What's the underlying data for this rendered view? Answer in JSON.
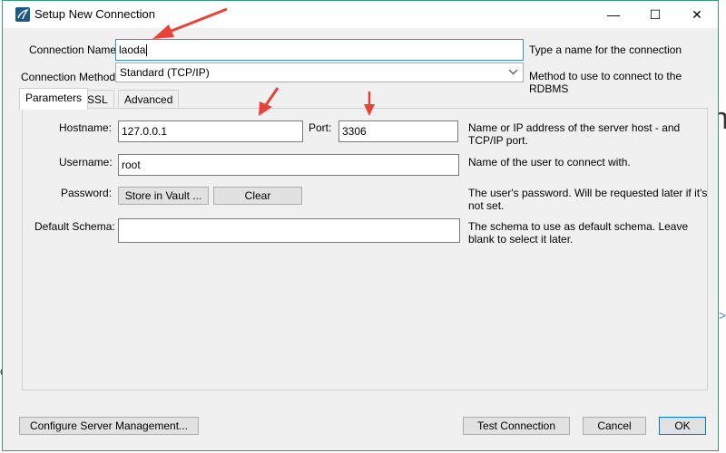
{
  "window": {
    "title": "Setup New Connection",
    "controls": {
      "minimize": "—",
      "maximize": "☐",
      "close": "✕"
    }
  },
  "connection_name": {
    "label": "Connection Name:",
    "value": "laoda",
    "hint": "Type a name for the connection"
  },
  "connection_method": {
    "label": "Connection Method:",
    "value": "Standard (TCP/IP)",
    "hint": "Method to use to connect to the RDBMS"
  },
  "tabs": [
    {
      "label": "Parameters",
      "active": true
    },
    {
      "label": "SSL",
      "active": false
    },
    {
      "label": "Advanced",
      "active": false
    }
  ],
  "params": {
    "hostname": {
      "label": "Hostname:",
      "value": "127.0.0.1"
    },
    "port": {
      "label": "Port:",
      "value": "3306"
    },
    "hostname_hint_1": "Name or IP address of the server host - and",
    "hostname_hint_2": "TCP/IP port.",
    "username": {
      "label": "Username:",
      "value": "root",
      "hint": "Name of the user to connect with."
    },
    "password": {
      "label": "Password:",
      "store_button": "Store in Vault ...",
      "clear_button": "Clear",
      "hint_1": "The user's password. Will be requested later if it's",
      "hint_2": "not set."
    },
    "default_schema": {
      "label": "Default Schema:",
      "value": "",
      "hint_1": "The schema to use as default schema. Leave",
      "hint_2": "blank to select it later."
    }
  },
  "footer": {
    "configure_button": "Configure Server Management...",
    "test_button": "Test Connection",
    "cancel_button": "Cancel",
    "ok_button": "OK"
  },
  "background": {
    "glyph_n": "n",
    "glyph_arrow": ">",
    "glyph_o": "o"
  },
  "colors": {
    "annotation_arrow": "#e8413a",
    "window_border": "#3a9a78",
    "focus_border": "#3a8fd6",
    "icon": "#1e5a86"
  }
}
